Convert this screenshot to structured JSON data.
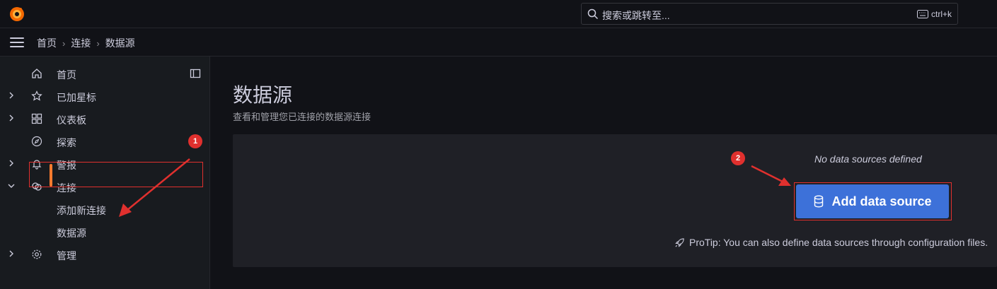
{
  "search": {
    "placeholder": "搜索或跳转至...",
    "shortcut": "ctrl+k"
  },
  "breadcrumb": {
    "home": "首页",
    "connections": "连接",
    "current": "数据源"
  },
  "sidebar": {
    "items": [
      {
        "label": "首页",
        "icon": "home-icon"
      },
      {
        "label": "已加星标",
        "icon": "star-icon"
      },
      {
        "label": "仪表板",
        "icon": "dashboards-icon"
      },
      {
        "label": "探索",
        "icon": "compass-icon"
      },
      {
        "label": "警报",
        "icon": "bell-icon"
      },
      {
        "label": "连接",
        "icon": "connections-icon"
      },
      {
        "label": "管理",
        "icon": "gear-icon"
      }
    ],
    "sub_items": [
      {
        "label": "添加新连接"
      },
      {
        "label": "数据源"
      }
    ]
  },
  "page": {
    "title": "数据源",
    "subtitle": "查看和管理您已连接的数据源连接"
  },
  "empty_state": {
    "message": "No data sources defined",
    "button_label": "Add data source",
    "protip": "ProTip: You can also define data sources through configuration files."
  },
  "annotations": {
    "badge1": "1",
    "badge2": "2"
  },
  "colors": {
    "accent": "#ff7b2e",
    "primary_button": "#3d71d9",
    "annotation_red": "#e0302e"
  }
}
